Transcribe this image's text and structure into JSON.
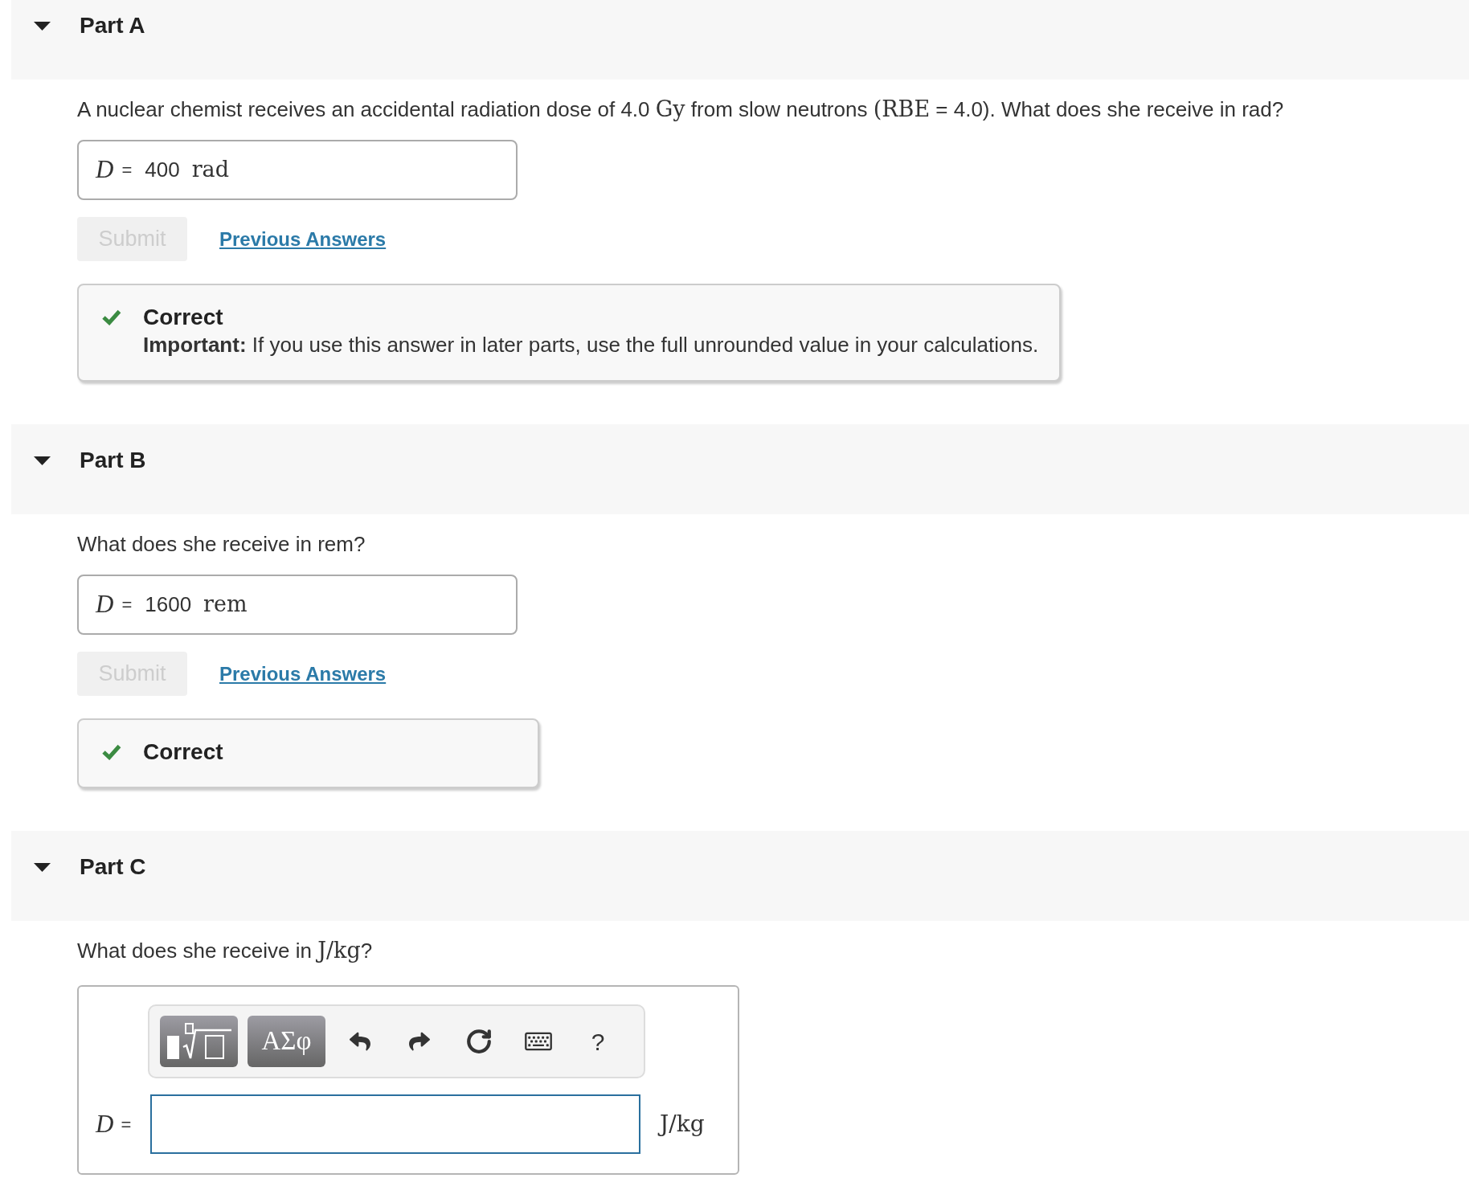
{
  "parts": [
    {
      "title": "Part A",
      "expanded": true,
      "kind": "submitted",
      "question": [
        {
          "kind": "text",
          "text": "A nuclear chemist receives an accidental radiation dose of 4.0 "
        },
        {
          "kind": "math",
          "text": "Gy"
        },
        {
          "kind": "text",
          "text": " from slow neutrons "
        },
        {
          "kind": "math",
          "text": "(RBE"
        },
        {
          "kind": "text",
          "text": " = 4.0). What does she receive in rad?"
        }
      ],
      "answer": {
        "variable": "D",
        "equals": "=",
        "value": "400",
        "unit": "rad"
      },
      "submit": {
        "label": "Submit",
        "disabled": true
      },
      "previous_answers": "Previous Answers",
      "feedback": {
        "correct": true,
        "title": "Correct",
        "message": "**Important:** If you use this answer in later parts, use the full unrounded value in your calculations."
      }
    },
    {
      "title": "Part B",
      "expanded": true,
      "kind": "submitted",
      "question": [
        {
          "kind": "text",
          "text": "What does she receive in rem?"
        }
      ],
      "answer": {
        "variable": "D",
        "equals": "=",
        "value": "1600",
        "unit": "rem"
      },
      "submit": {
        "label": "Submit",
        "disabled": true
      },
      "previous_answers": "Previous Answers",
      "feedback": {
        "correct": true,
        "title": "Correct"
      }
    },
    {
      "title": "Part C",
      "expanded": true,
      "kind": "editor",
      "question": [
        {
          "kind": "text",
          "text": "What does she receive in "
        },
        {
          "kind": "math",
          "text": "J/kg"
        },
        {
          "kind": "text",
          "text": "?"
        }
      ],
      "editor": {
        "toolbar": [
          {
            "kind": "templates"
          },
          {
            "kind": "symbols",
            "label": "ΑΣφ"
          },
          {
            "kind": "undo"
          },
          {
            "kind": "redo"
          },
          {
            "kind": "reset"
          },
          {
            "kind": "keyboard"
          },
          {
            "kind": "help",
            "label": "?"
          }
        ],
        "variable": "D",
        "equals": "=",
        "unit": "J/kg"
      }
    }
  ]
}
